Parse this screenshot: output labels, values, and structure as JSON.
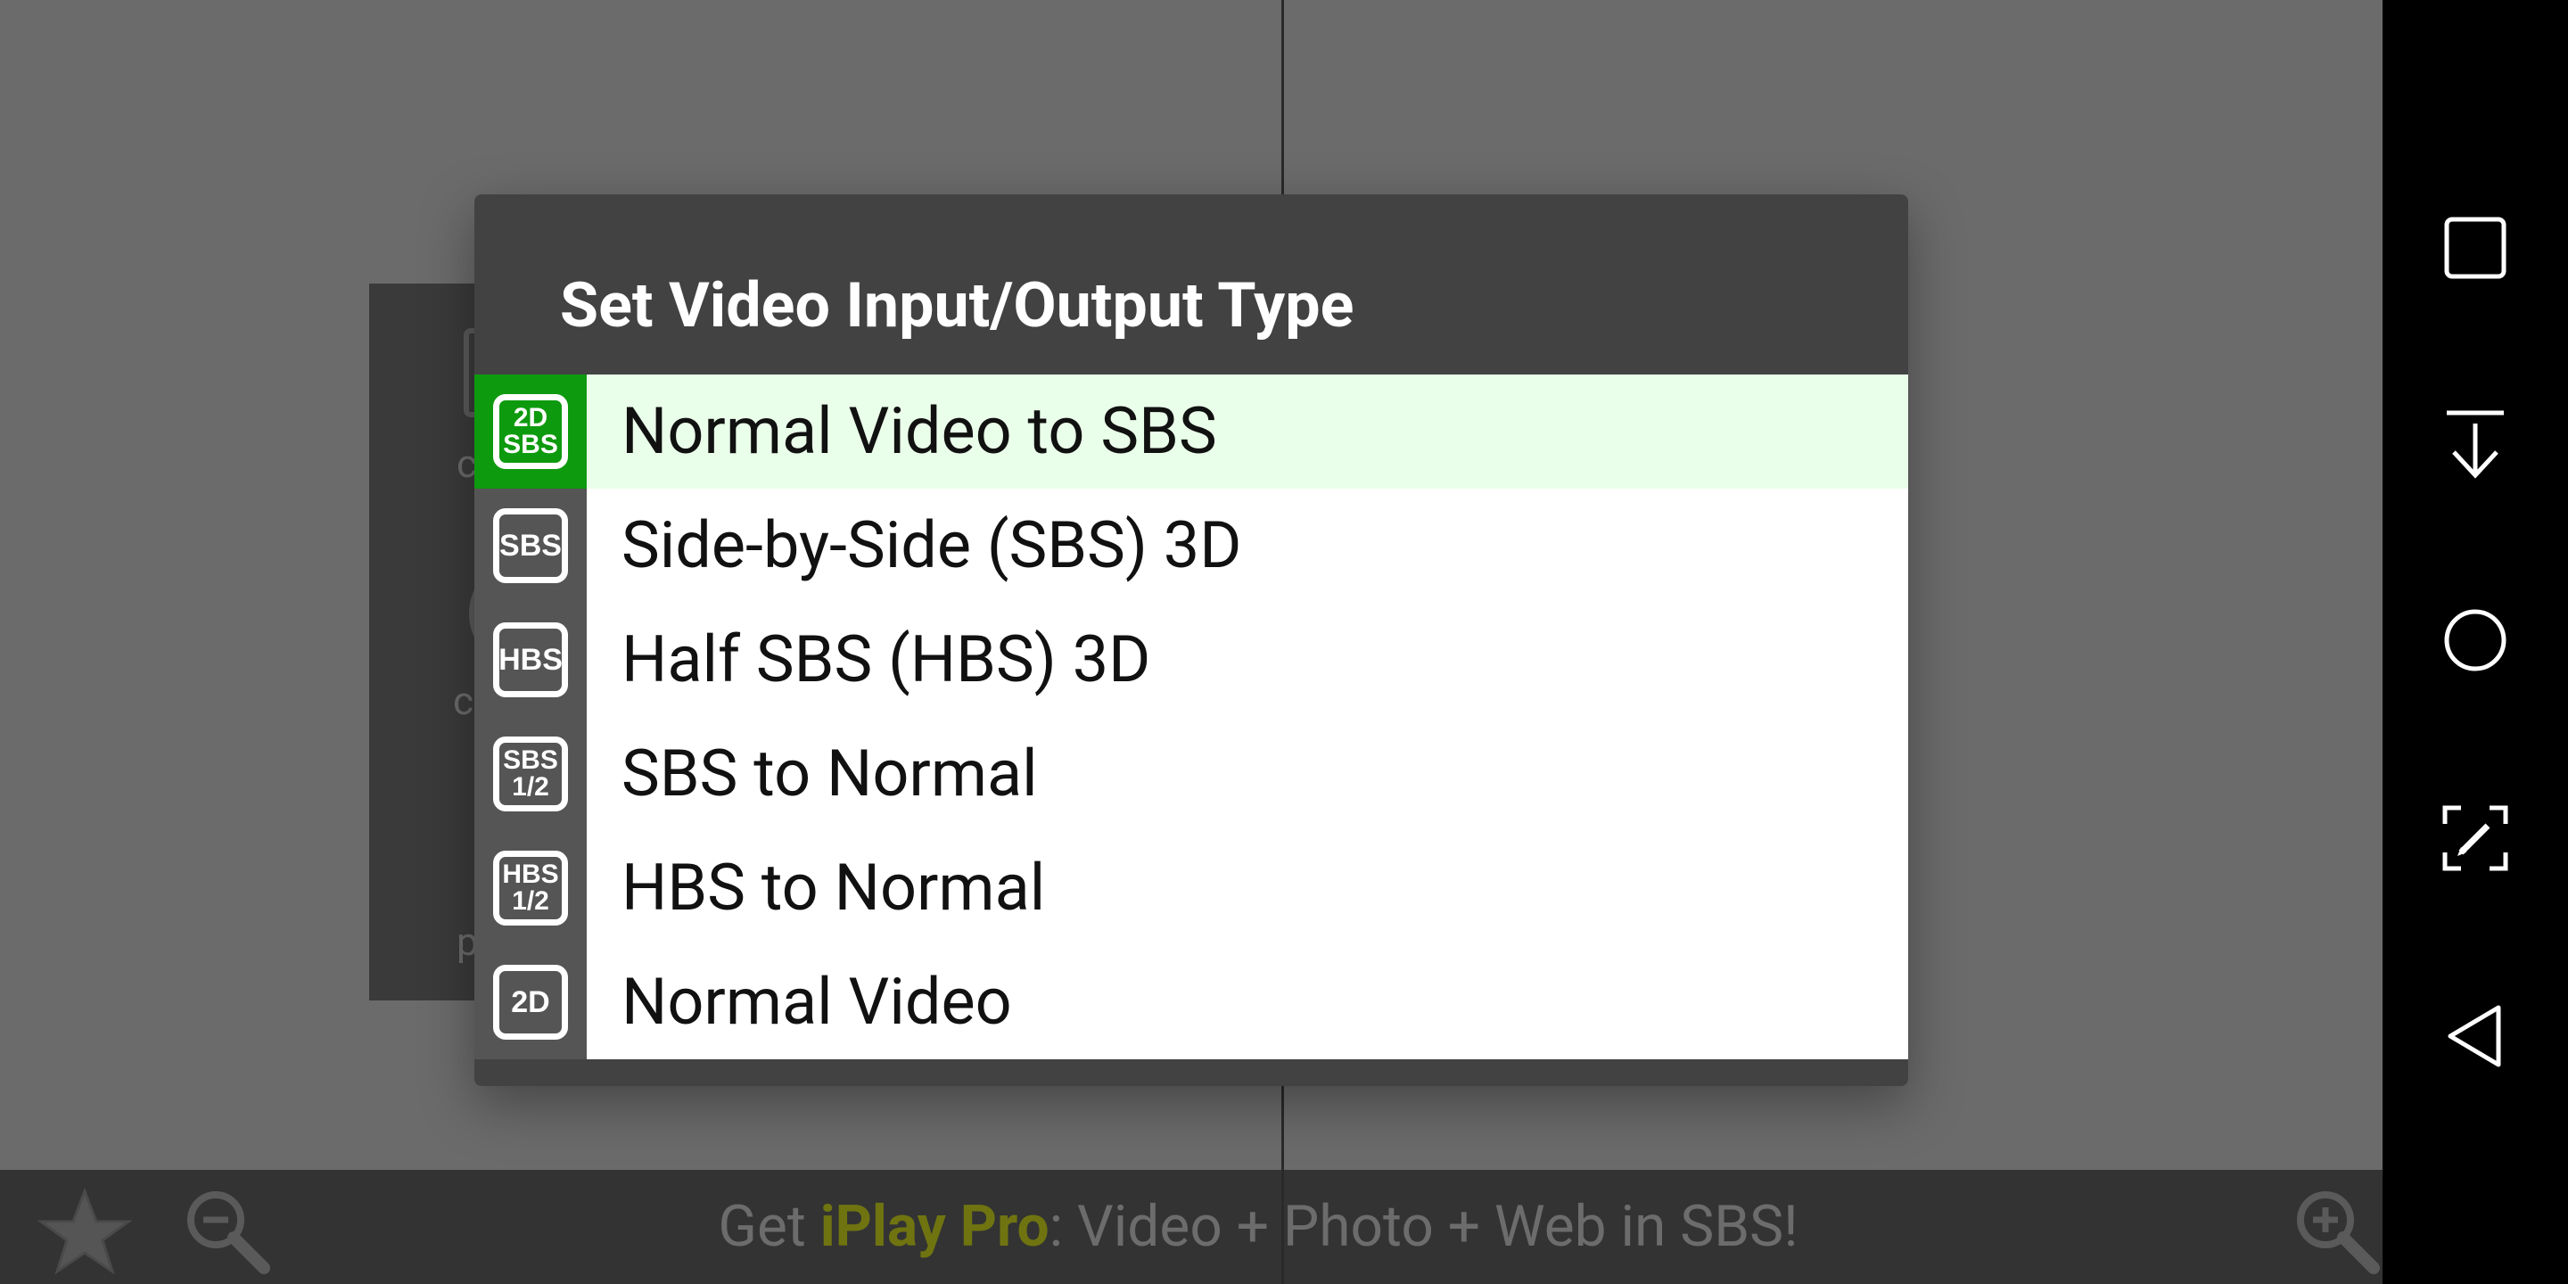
{
  "dialog": {
    "title": "Set Video Input/Output Type",
    "options": [
      {
        "label": "Normal Video to SBS",
        "badge": [
          "2D",
          "SBS"
        ],
        "selected": true
      },
      {
        "label": "Side-by-Side (SBS) 3D",
        "badge": [
          "SBS"
        ],
        "selected": false
      },
      {
        "label": "Half SBS (HBS) 3D",
        "badge": [
          "HBS"
        ],
        "selected": false
      },
      {
        "label": "SBS to Normal",
        "badge": [
          "SBS",
          "1/2"
        ],
        "selected": false
      },
      {
        "label": "HBS to Normal",
        "badge": [
          "HBS",
          "1/2"
        ],
        "selected": false
      },
      {
        "label": "Normal Video",
        "badge": [
          "2D"
        ],
        "selected": false
      }
    ]
  },
  "promo": {
    "prefix": "Get ",
    "brand": "iPlay Pro",
    "suffix": ": Video + Photo + Web in SBS!"
  },
  "background_fragments": [
    "c",
    "c",
    "p"
  ],
  "bottom_bar": {
    "icons": [
      "star-icon",
      "zoom-out-icon",
      "zoom-in-icon"
    ]
  },
  "nav_bar": {
    "buttons": [
      "recents-button",
      "notification-pull-button",
      "home-button",
      "screenshot-edit-button",
      "back-button"
    ]
  },
  "colors": {
    "selected_icon_bg": "#0e9a0e",
    "selected_row_bg": "#eaffea",
    "dialog_bg": "#424242",
    "promo_accent": "#6f7410"
  }
}
